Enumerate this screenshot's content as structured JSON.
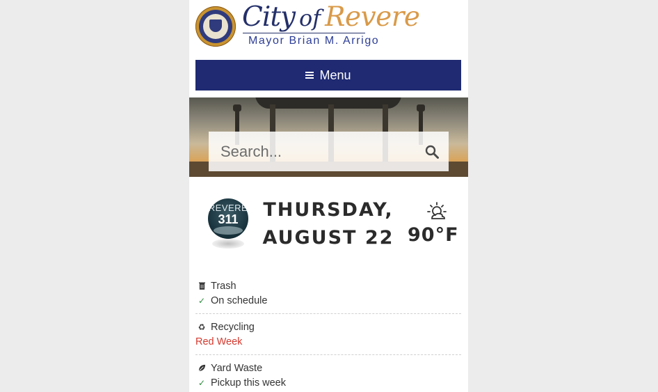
{
  "header": {
    "logo_city": "City",
    "logo_of": "of",
    "logo_revere": "Revere",
    "mayor": "Mayor Brian M. Arrigo"
  },
  "nav": {
    "menu_label": "Menu"
  },
  "search": {
    "placeholder": "Search..."
  },
  "badge": {
    "line1": "REVERE",
    "line2": "311"
  },
  "date": {
    "weekday": "THURSDAY,",
    "day": "AUGUST 22"
  },
  "weather": {
    "temp": "90°F",
    "icon": "sun-cloud-icon"
  },
  "services": [
    {
      "title": "Trash",
      "status": "On schedule",
      "icon": "trash-icon",
      "status_icon": "check-icon"
    },
    {
      "title": "Recycling",
      "status": "Red Week",
      "icon": "recycle-icon",
      "status_color": "#d43a2f"
    },
    {
      "title": "Yard Waste",
      "status": "Pickup this week",
      "icon": "leaf-icon",
      "status_icon": "check-icon"
    }
  ],
  "colors": {
    "nav_bg": "#1f2a72",
    "brand_gold": "#d99a49",
    "check_green": "#2e8b3d",
    "alert_red": "#d43a2f"
  }
}
